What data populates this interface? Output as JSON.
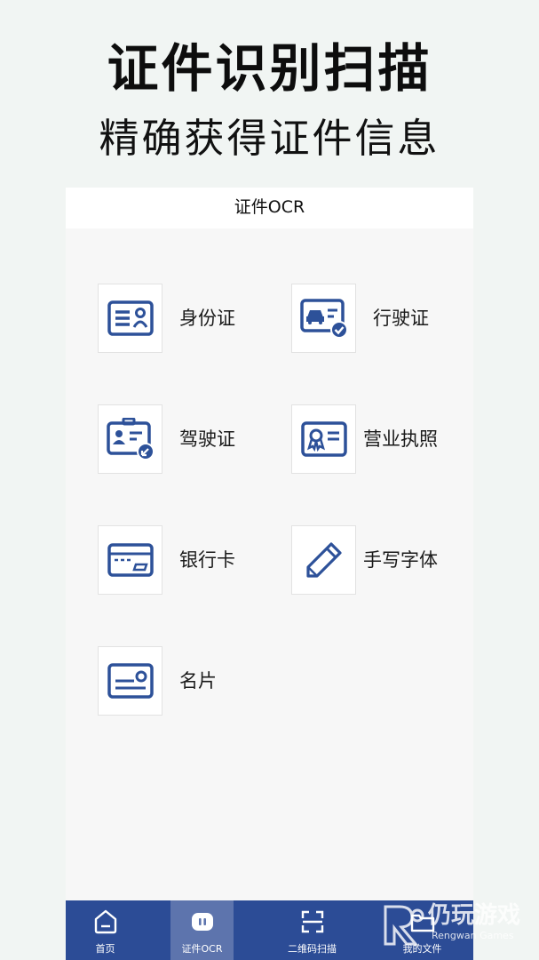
{
  "promo": {
    "title": "证件识别扫描",
    "subtitle": "精确获得证件信息"
  },
  "appbar": {
    "title": "证件OCR"
  },
  "grid": [
    {
      "label": "身份证",
      "icon": "id-card-icon"
    },
    {
      "label": "行驶证",
      "icon": "vehicle-license-icon"
    },
    {
      "label": "驾驶证",
      "icon": "driver-license-icon"
    },
    {
      "label": "营业执照",
      "icon": "business-license-icon"
    },
    {
      "label": "银行卡",
      "icon": "bank-card-icon"
    },
    {
      "label": "手写字体",
      "icon": "pen-icon"
    },
    {
      "label": "名片",
      "icon": "business-card-icon"
    }
  ],
  "tabs": [
    {
      "label": "首页",
      "icon": "home-icon",
      "active": false
    },
    {
      "label": "证件OCR",
      "icon": "ocr-icon",
      "active": true
    },
    {
      "label": "二维码扫描",
      "icon": "scan-icon",
      "active": false
    },
    {
      "label": "我的文件",
      "icon": "folder-icon",
      "active": false
    }
  ],
  "watermark": {
    "brand_cn": "仍玩游戏",
    "brand_en": "Rengwan Games"
  },
  "colors": {
    "accent": "#2c4c96",
    "icon": "#2d5199",
    "tab_active": "#5d74ad",
    "background": "#f1f5f3"
  }
}
